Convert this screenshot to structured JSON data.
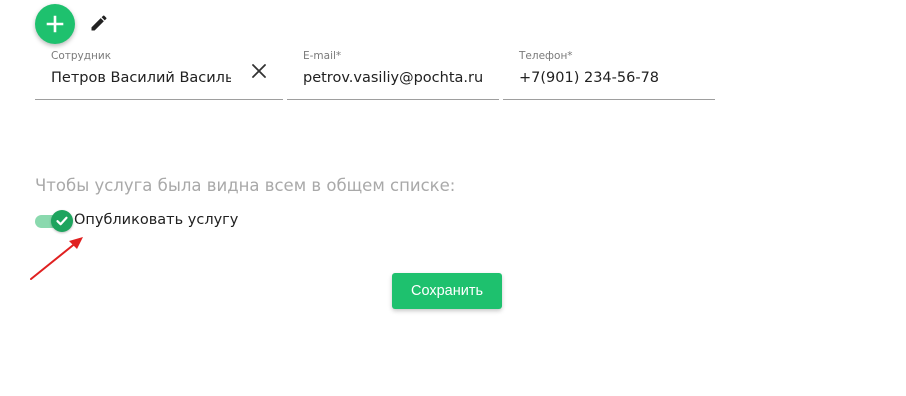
{
  "toolbar": {
    "add_icon": "plus-icon",
    "edit_icon": "pencil-icon"
  },
  "form": {
    "employee": {
      "label": "Сотрудник",
      "value": "Петров Василий Васильевич",
      "clear_icon": "close-icon"
    },
    "email": {
      "label": "E-mail*",
      "value": "petrov.vasiliy@pochta.ru"
    },
    "phone": {
      "label": "Телефон*",
      "value": "+7(901) 234-56-78"
    }
  },
  "visibility": {
    "hint": "Чтобы услуга была видна всем в общем списке:",
    "publish_label": "Опубликовать услугу",
    "publish_checked": true
  },
  "actions": {
    "save_label": "Сохранить"
  },
  "colors": {
    "accent": "#1ec16e",
    "switch_thumb": "#1ea45e",
    "annotation_arrow": "#e02020"
  }
}
